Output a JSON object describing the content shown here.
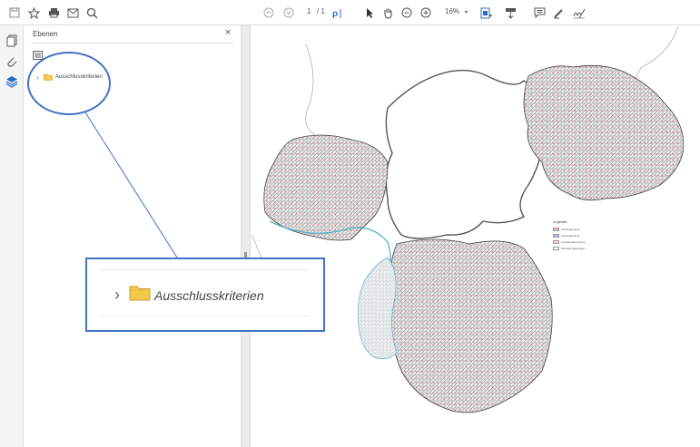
{
  "toolbar": {
    "page_current": "1",
    "page_total": "/ 1",
    "zoom_level": "16%",
    "icons": [
      "save-icon",
      "bookmark-star-icon",
      "print-icon",
      "email-icon",
      "search-zoom-icon",
      "page-up-icon",
      "page-down-icon",
      "find-text-icon",
      "select-pointer-icon",
      "hand-icon",
      "zoom-out-icon",
      "zoom-in-icon",
      "fit-page-icon",
      "page-scroll-icon",
      "comment-icon",
      "highlight-icon",
      "sign-icon"
    ]
  },
  "rail": {
    "icons": [
      "pages-icon",
      "attachment-icon",
      "layers-icon"
    ]
  },
  "panel": {
    "title": "Ebenen",
    "close": "×",
    "layer_label": "Ausschlusskriterien"
  },
  "legend": {
    "title": "Legende",
    "items": [
      {
        "text": "Vorranggebiete ...",
        "color": "#f4b8b8"
      },
      {
        "text": "Vorranggebiete ...",
        "color": "#b9b9e6"
      },
      {
        "text": "Konzentrationszone ...",
        "color": "#f6d9d9"
      },
      {
        "text": "Windenergieanlage ...",
        "color": "#ffffff"
      }
    ]
  },
  "callout": {
    "layer_label": "Ausschlusskriterien",
    "accent": "#4472c4"
  }
}
